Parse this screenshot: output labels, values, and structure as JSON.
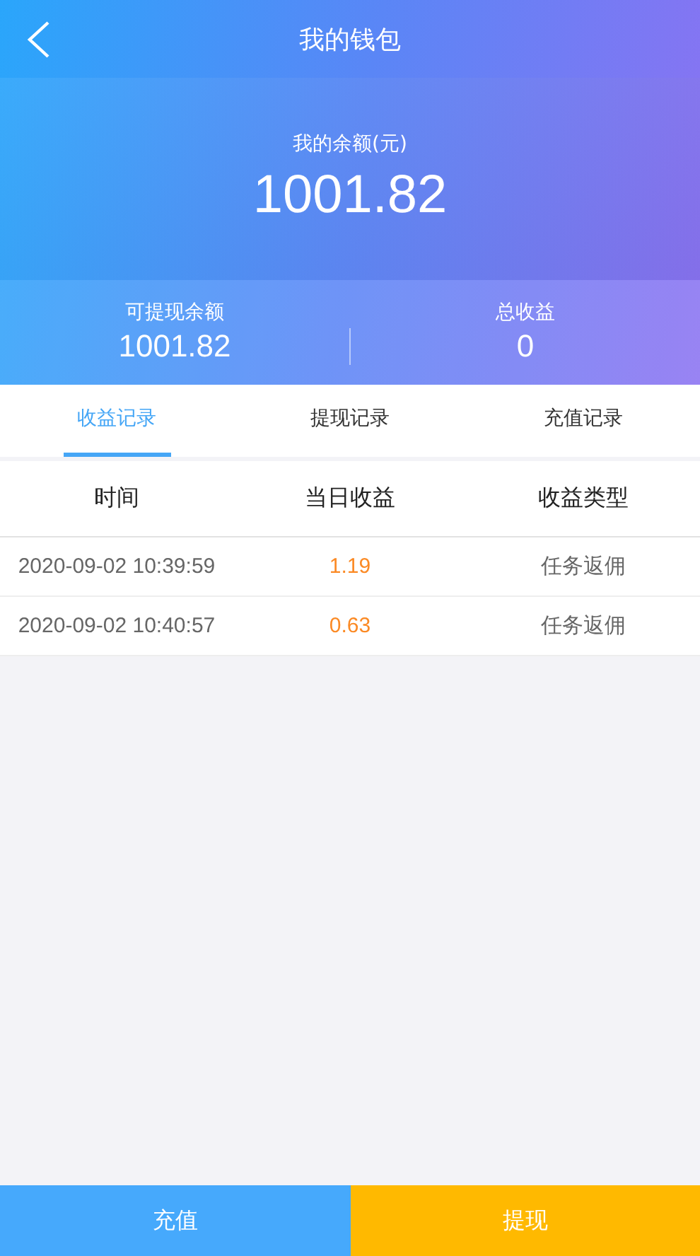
{
  "header": {
    "title": "我的钱包"
  },
  "balance": {
    "label": "我的余额(元)",
    "amount": "1001.82"
  },
  "stats": [
    {
      "label": "可提现余额",
      "value": "1001.82"
    },
    {
      "label": "总收益",
      "value": "0"
    }
  ],
  "tabs": [
    {
      "label": "收益记录",
      "selected": true
    },
    {
      "label": "提现记录",
      "selected": false
    },
    {
      "label": "充值记录",
      "selected": false
    }
  ],
  "table": {
    "columns": [
      "时间",
      "当日收益",
      "收益类型"
    ],
    "rows": [
      [
        "2020-09-02 10:39:59",
        "1.19",
        "任务返佣"
      ],
      [
        "2020-09-02 10:40:57",
        "0.63",
        "任务返佣"
      ]
    ]
  },
  "buttons": [
    {
      "label": "充值",
      "kind": "recharge"
    },
    {
      "label": "提现",
      "kind": "withdraw"
    }
  ]
}
